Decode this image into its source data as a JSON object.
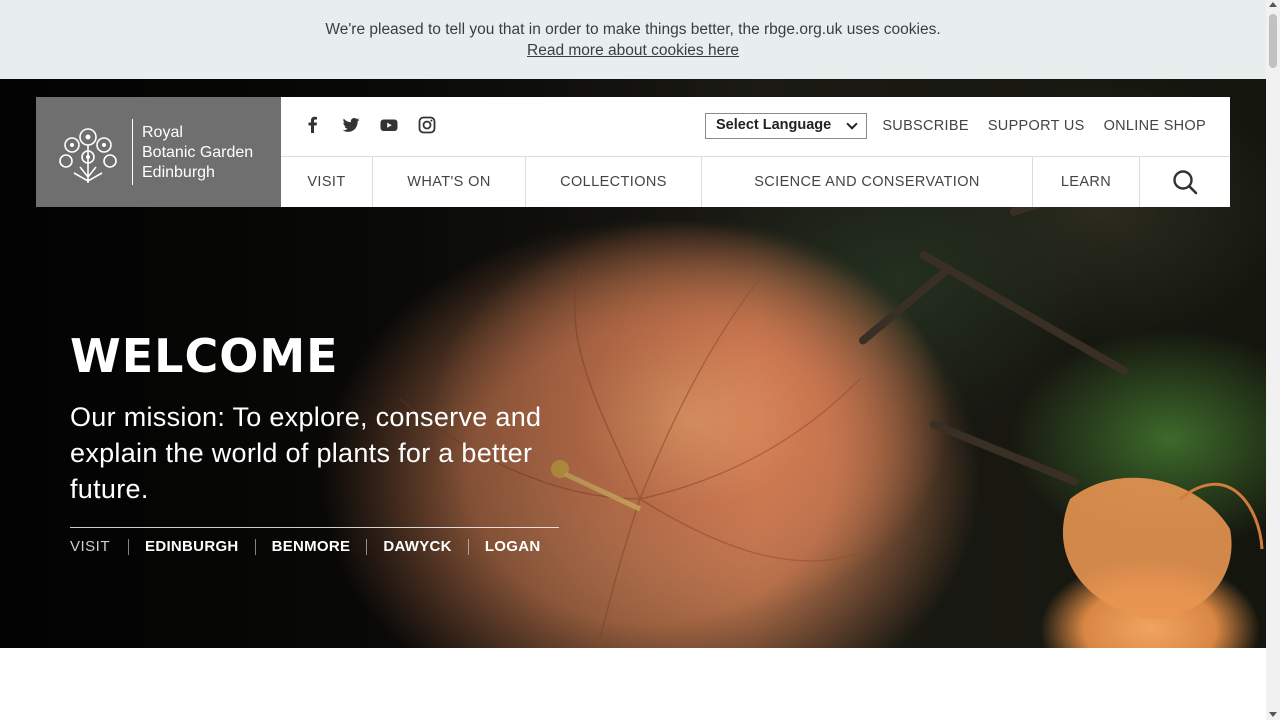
{
  "cookie_banner": {
    "message": "We're pleased to tell you that in order to make things better, the rbge.org.uk uses cookies.",
    "link_text": "Read more about cookies here"
  },
  "logo": {
    "line1": "Royal",
    "line2": "Botanic Garden",
    "line3": "Edinburgh",
    "emblem_icon": "botanic-flower-emblem-icon"
  },
  "social": [
    "facebook-icon",
    "twitter-icon",
    "youtube-icon",
    "instagram-icon"
  ],
  "language_select": {
    "label": "Select Language"
  },
  "utility_nav": [
    {
      "label": "SUBSCRIBE"
    },
    {
      "label": "SUPPORT US"
    },
    {
      "label": "ONLINE SHOP"
    }
  ],
  "main_nav": [
    {
      "label": "VISIT"
    },
    {
      "label": "WHAT'S ON"
    },
    {
      "label": "COLLECTIONS"
    },
    {
      "label": "SCIENCE AND CONSERVATION"
    },
    {
      "label": "LEARN"
    }
  ],
  "search": {
    "icon": "search-icon"
  },
  "hero": {
    "title": "WELCOME",
    "mission": "Our mission: To explore, conserve and explain the world of plants for a better future.",
    "visit_label": "VISIT",
    "gardens": [
      "EDINBURGH",
      "BENMORE",
      "DAWYCK",
      "LOGAN"
    ]
  },
  "colors": {
    "banner_bg": "#e8eeee",
    "logo_bg": "#6f6f6f",
    "hero_flower": "#c98a63"
  }
}
